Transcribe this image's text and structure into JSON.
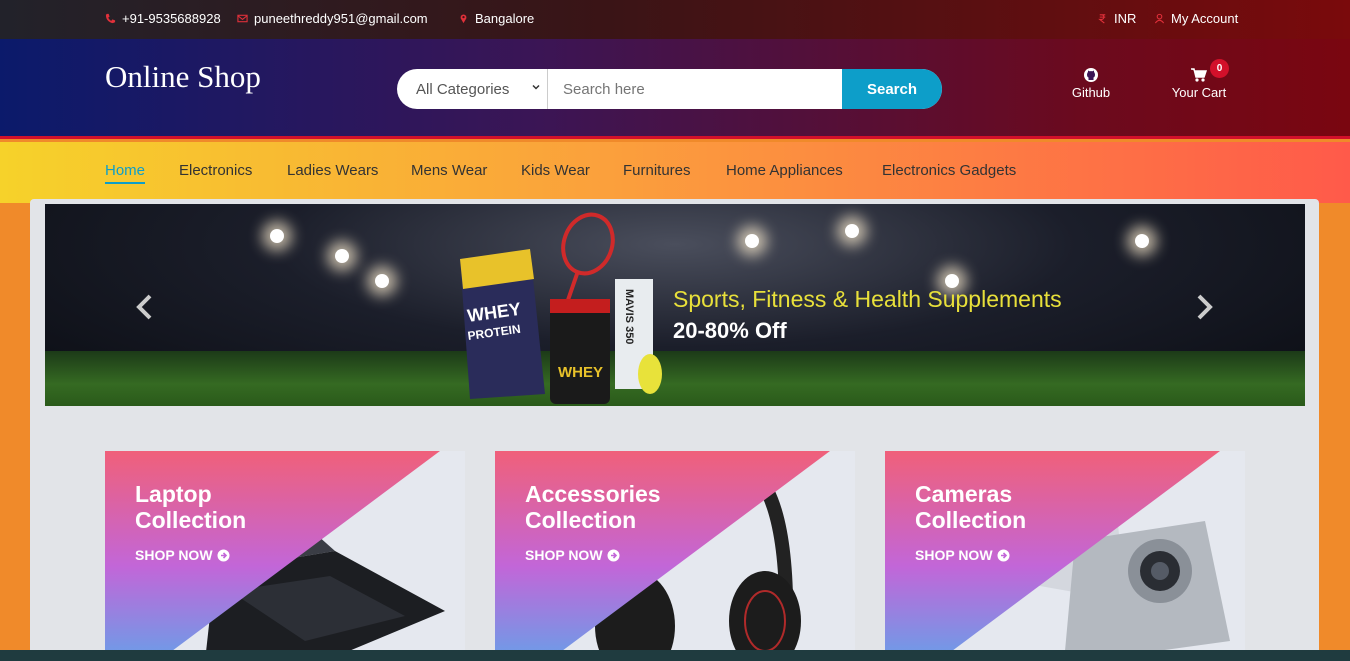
{
  "topbar": {
    "phone": "+91-9535688928",
    "email": "puneethreddy951@gmail.com",
    "location": "Bangalore",
    "currency": "INR",
    "account": "My Account"
  },
  "header": {
    "logo": "Online Shop",
    "category_selected": "All Categories",
    "search_placeholder": "Search here",
    "search_button": "Search",
    "github_label": "Github",
    "cart_label": "Your Cart",
    "cart_count": "0"
  },
  "nav": {
    "items": [
      "Home",
      "Electronics",
      "Ladies Wears",
      "Mens Wear",
      "Kids Wear",
      "Furnitures",
      "Home Appliances",
      "Electronics Gadgets"
    ]
  },
  "slider": {
    "title": "Sports, Fitness & Health Supplements",
    "subtitle": "20-80% Off"
  },
  "collections": [
    {
      "line1": "Laptop",
      "line2": "Collection",
      "cta": "SHOP NOW"
    },
    {
      "line1": "Accessories",
      "line2": "Collection",
      "cta": "SHOP NOW"
    },
    {
      "line1": "Cameras",
      "line2": "Collection",
      "cta": "SHOP NOW"
    }
  ],
  "colors": {
    "accent": "#0d9ec9",
    "badge": "#d2102a",
    "slide_title": "#e8e03a"
  }
}
